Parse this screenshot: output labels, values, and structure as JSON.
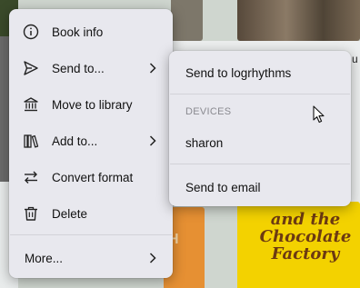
{
  "main_menu": {
    "items": [
      {
        "label": "Book info",
        "icon": "info-icon"
      },
      {
        "label": "Send to...",
        "icon": "send-icon",
        "has_submenu": true
      },
      {
        "label": "Move to library",
        "icon": "library-icon"
      },
      {
        "label": "Add to...",
        "icon": "books-icon",
        "has_submenu": true
      },
      {
        "label": "Convert format",
        "icon": "convert-icon"
      },
      {
        "label": "Delete",
        "icon": "trash-icon"
      }
    ],
    "more_label": "More..."
  },
  "send_to_submenu": {
    "primary_target": "Send to logrhythms",
    "devices_header": "DEVICES",
    "devices": [
      "sharon"
    ],
    "email_label": "Send to email"
  },
  "background": {
    "cover_left_text": "H",
    "cover_right_text": "and the Chocolate Factory",
    "cover_top_fragment": "u"
  }
}
